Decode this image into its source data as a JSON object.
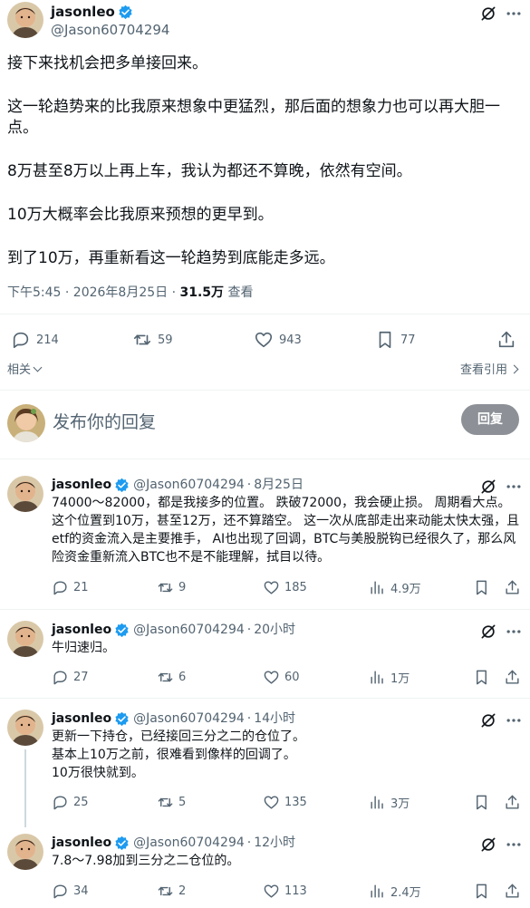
{
  "main_tweet": {
    "name": "jasonleo",
    "handle": "@Jason60704294",
    "paragraphs": [
      "接下来找机会把多单接回来。",
      "这一轮趋势来的比我原来想象中更猛烈，那后面的想象力也可以再大胆一点。",
      "8万甚至8万以上再上车，我认为都还不算晚，依然有空间。",
      "10万大概率会比我原来预想的更早到。",
      "到了10万，再重新看这一轮趋势到底能走多远。"
    ],
    "timestamp": "下午5:45 · 2026年8月25日 · ",
    "views_count": "31.5万",
    "views_label": " 查看",
    "stats": {
      "replies": "214",
      "retweets": "59",
      "likes": "943",
      "bookmarks": "77"
    },
    "related_label": "相关",
    "quotes_label": "查看引用"
  },
  "compose": {
    "placeholder": "发布你的回复",
    "button": "回复"
  },
  "replies": [
    {
      "name": "jasonleo",
      "handle": "@Jason60704294",
      "time": "8月25日",
      "text": "74000～82000，都是我接多的位置。 跌破72000，我会硬止损。 周期看大点。 这个位置到10万，甚至12万，还不算踏空。 这一次从底部走出来动能太快太强，且etf的资金流入是主要推手， AI也出现了回调，BTC与美股脱钩已经很久了，那么风险资金重新流入BTC也不是不能理解，拭目以待。",
      "replies": "21",
      "retweets": "9",
      "likes": "185",
      "views": "4.9万"
    },
    {
      "name": "jasonleo",
      "handle": "@Jason60704294",
      "time": "20小时",
      "text": "牛归速归。",
      "replies": "27",
      "retweets": "6",
      "likes": "60",
      "views": "1万"
    },
    {
      "name": "jasonleo",
      "handle": "@Jason60704294",
      "time": "14小时",
      "text": "更新一下持仓，已经接回三分之二的仓位了。\n基本上10万之前，很难看到像样的回调了。\n10万很快就到。",
      "replies": "25",
      "retweets": "5",
      "likes": "135",
      "views": "3万"
    },
    {
      "name": "jasonleo",
      "handle": "@Jason60704294",
      "time": "12小时",
      "text": "7.8～7.98加到三分之二仓位的。",
      "replies": "34",
      "retweets": "2",
      "likes": "113",
      "views": "2.4万"
    }
  ],
  "colors": {
    "verified": "#1d9bf0",
    "secondary_text": "#536471",
    "divider": "#eff3f4",
    "reply_button_disabled": "#8d9197"
  },
  "icons": [
    "verified-icon",
    "grok-icon",
    "more-icon",
    "reply-icon",
    "retweet-icon",
    "like-icon",
    "bookmark-icon",
    "share-icon",
    "views-icon",
    "chevron-down-icon",
    "chevron-right-icon"
  ]
}
